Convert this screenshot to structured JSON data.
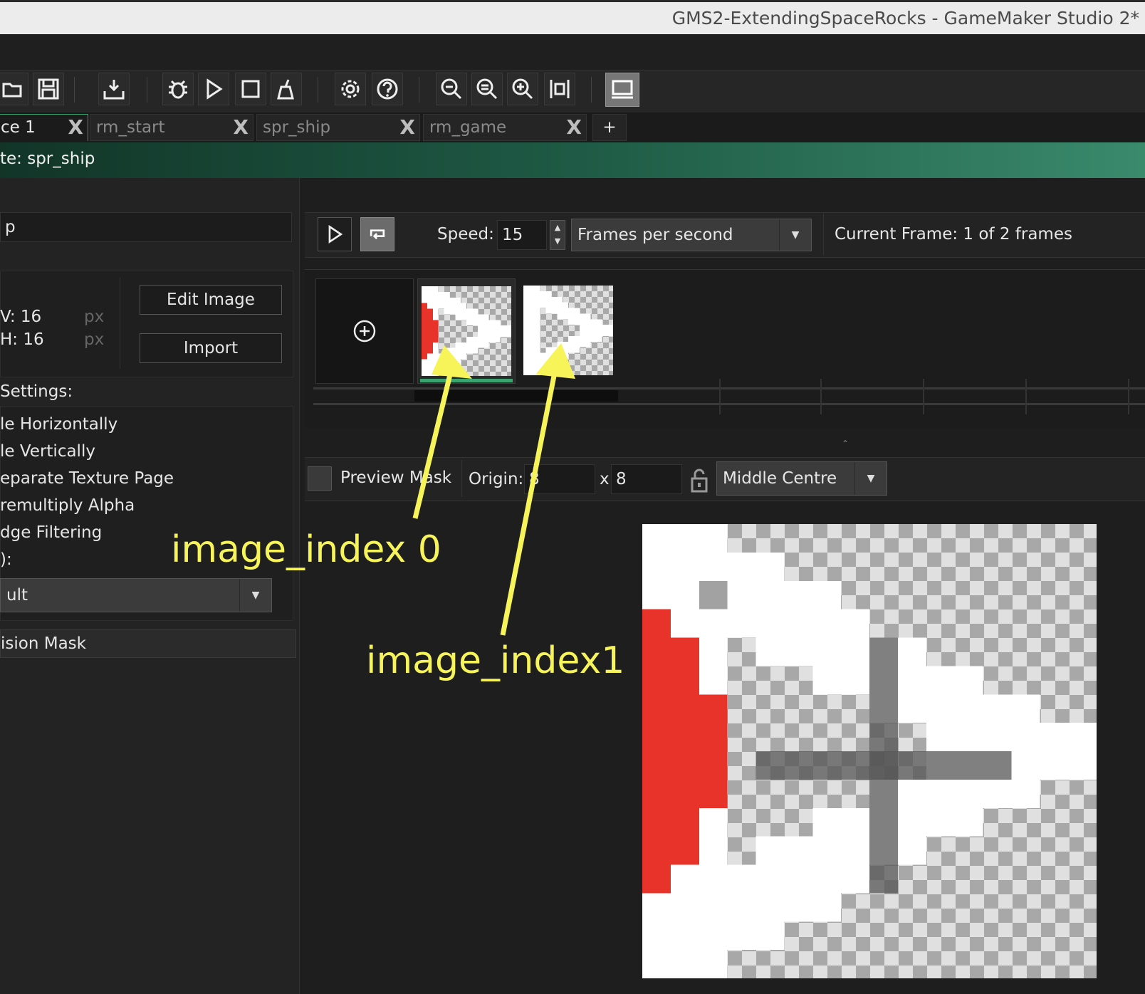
{
  "window": {
    "title": "GMS2-ExtendingSpaceRocks - GameMaker Studio 2*"
  },
  "toolbar": {
    "icons": [
      "open-icon",
      "save-icon",
      "export-icon",
      "debug-icon",
      "run-icon",
      "stop-icon",
      "clean-icon",
      "settings-icon",
      "help-icon",
      "zoom-out-icon",
      "zoom-reset-icon",
      "zoom-in-icon",
      "fit-icon",
      "monitor-icon"
    ]
  },
  "tabs": [
    {
      "label": "ce 1",
      "close": "X"
    },
    {
      "label": "rm_start",
      "close": "X"
    },
    {
      "label": "spr_ship",
      "close": "X"
    },
    {
      "label": "rm_game",
      "close": "X"
    }
  ],
  "new_tab_label": "+",
  "header": {
    "title": "te: spr_ship"
  },
  "left": {
    "name_value": "p",
    "edit_image": "Edit Image",
    "import": "Import",
    "width_label": "V: 16",
    "height_label": "H: 16",
    "unit": "px",
    "settings_label": " Settings:",
    "options": [
      "le Horizontally",
      "le Vertically",
      "eparate Texture Page",
      "remultiply Alpha",
      "dge Filtering"
    ],
    "group_label": "):",
    "group_value": "ult",
    "collision_mask": "ision Mask"
  },
  "anim": {
    "speed_label": "Speed:",
    "speed_value": "15",
    "speed_unit": "Frames per second",
    "current_frame": "Current Frame: 1 of 2 frames",
    "add_frame_icon": "plus-circle-icon"
  },
  "origin": {
    "preview_mask": "Preview Mask",
    "origin_label": "Origin:",
    "x_value": "8",
    "x_sep": "x",
    "y_value": "8",
    "preset": "Middle Centre",
    "lock_icon": "lock-icon"
  },
  "annotations": {
    "frame0": "image_index 0",
    "frame1": "image_index1",
    "color": "#f7f45a"
  },
  "colors": {
    "accent": "#3ba36f",
    "ship_red": "#e8332a"
  }
}
